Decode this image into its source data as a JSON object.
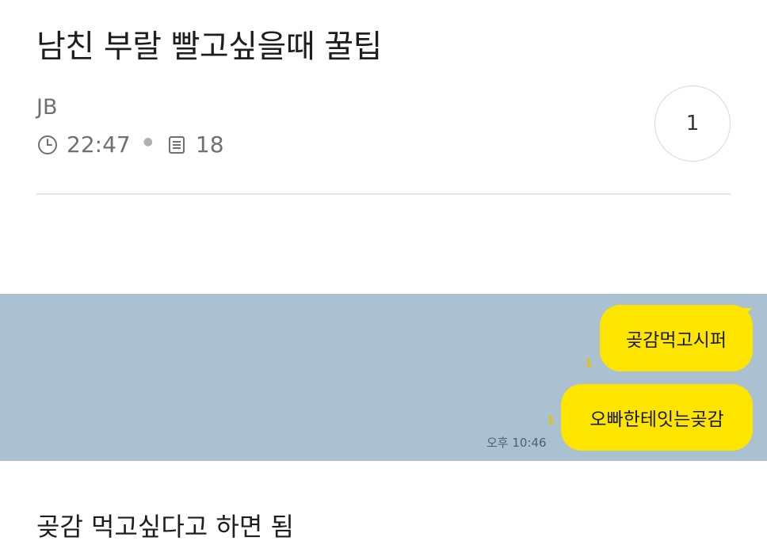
{
  "post": {
    "title": "남친 부랄 빨고싶을때 꿀팁",
    "author": "JB",
    "time": "22:47",
    "views": "18",
    "comment_count": "1"
  },
  "chat": {
    "messages": [
      {
        "text": "곶감먹고시퍼",
        "unread": "1"
      },
      {
        "text": "오빠한테잇는곶감",
        "unread": "1"
      }
    ],
    "timestamp": "오후 10:46",
    "bubble_color": "#fee500",
    "background_color": "#abc1d1"
  },
  "caption": "곶감 먹고싶다고 하면 됨",
  "icons": {
    "time": "clock-icon",
    "views": "document-icon"
  }
}
